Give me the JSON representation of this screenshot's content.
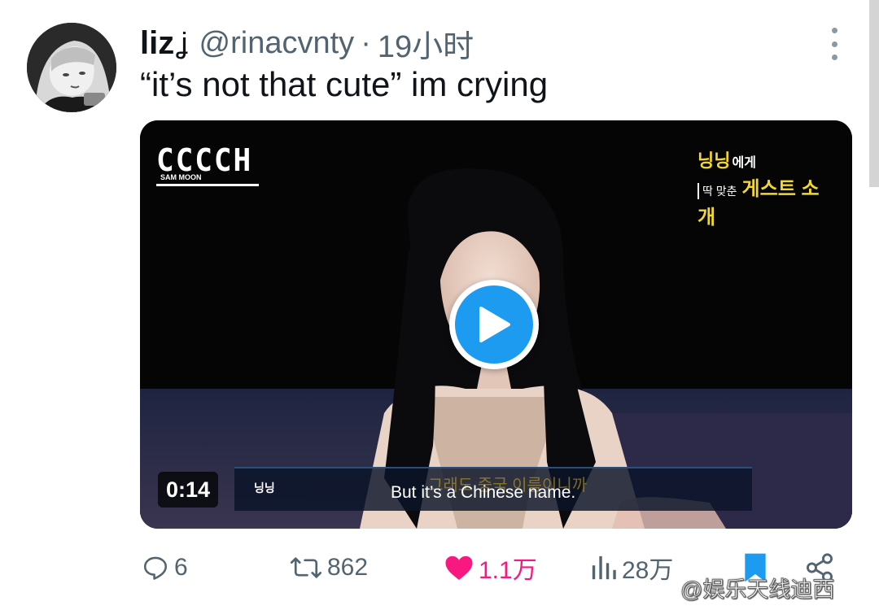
{
  "user": {
    "display_name": "liz",
    "name_emoji": "ʝ",
    "handle": "@rinacvnty",
    "separator": "·",
    "time": "19小时"
  },
  "tweet": {
    "text": "“it’s not that cute” im crying"
  },
  "video": {
    "channel_logo": "CCCCH",
    "channel_sub": "SAM MOON",
    "corner_line1": "닝닝",
    "corner_line1_suffix": "에게",
    "corner_line2_prefix": "딱 맞춘",
    "corner_line2": "게스트 소개",
    "duration": "0:14",
    "speaker": "닝닝",
    "korean_subtitle": "그래도 중국 이름이니까",
    "english_subtitle": "But it’s a Chinese name."
  },
  "actions": {
    "reply_count": "6",
    "retweet_count": "862",
    "like_count": "1.1万",
    "views_count": "28万"
  },
  "colors": {
    "accent_blue": "#1d9bf0",
    "like_pink": "#f91880",
    "text_primary": "#0f1419",
    "text_secondary": "#536471"
  },
  "watermark": "@娱乐天线迪西",
  "icons": [
    "more-icon",
    "play-icon",
    "reply-icon",
    "retweet-icon",
    "heart-icon",
    "views-icon",
    "bookmark-icon",
    "share-icon"
  ]
}
